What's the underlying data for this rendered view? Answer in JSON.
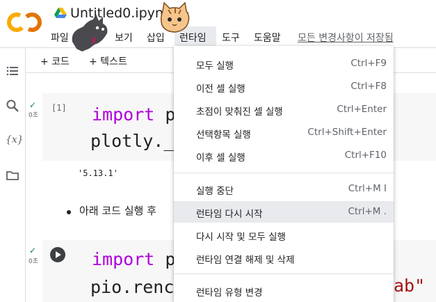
{
  "header": {
    "logo_text": "CO",
    "doc_title": "Untitled0.ipynb",
    "menu": [
      "파일",
      "수정",
      "보기",
      "삽입",
      "런타임",
      "도구",
      "도움말"
    ],
    "saved_status": "모든 변경사항이 저장됨"
  },
  "toolbar": {
    "add_code": "+ 코드",
    "add_text": "+ 텍스트"
  },
  "left_rail": [
    "table-of-contents-icon",
    "search-icon",
    "variables-icon",
    "folder-icon"
  ],
  "cells": [
    {
      "check": "✓",
      "exec_time": "0초",
      "count": "[1]",
      "line1_kw": "import",
      "line1_rest": " p",
      "line2": "plotly._",
      "output": "'5.13.1'"
    },
    {
      "check": "✓",
      "exec_time": "0초",
      "line1_kw": "import",
      "line1_rest": " p",
      "line2": "pio.renc",
      "line2_tail": "ab\""
    }
  ],
  "bullet": "아래 코드 실행 후",
  "runtime_menu": {
    "items": [
      {
        "label": "모두 실행",
        "shortcut": "Ctrl+F9"
      },
      {
        "label": "이전 셀 실행",
        "shortcut": "Ctrl+F8"
      },
      {
        "label": "초점이 맞춰진 셀 실행",
        "shortcut": "Ctrl+Enter"
      },
      {
        "label": "선택항목 실행",
        "shortcut": "Ctrl+Shift+Enter"
      },
      {
        "label": "이후 셀 실행",
        "shortcut": "Ctrl+F10"
      },
      {
        "label": "실행 중단",
        "shortcut": "Ctrl+M I"
      },
      {
        "label": "런타임 다시 시작",
        "shortcut": "Ctrl+M ."
      },
      {
        "label": "다시 시작 및 모두 실행",
        "shortcut": ""
      },
      {
        "label": "런타임 연결 해제 및 삭제",
        "shortcut": ""
      },
      {
        "label": "런타임 유형 변경",
        "shortcut": ""
      }
    ],
    "highlighted": "런타임 다시 시작"
  },
  "colors": {
    "logo_orange": "#f9ab00",
    "logo_dark_orange": "#e37400",
    "keyword": "#af00db",
    "check_green": "#188038"
  }
}
